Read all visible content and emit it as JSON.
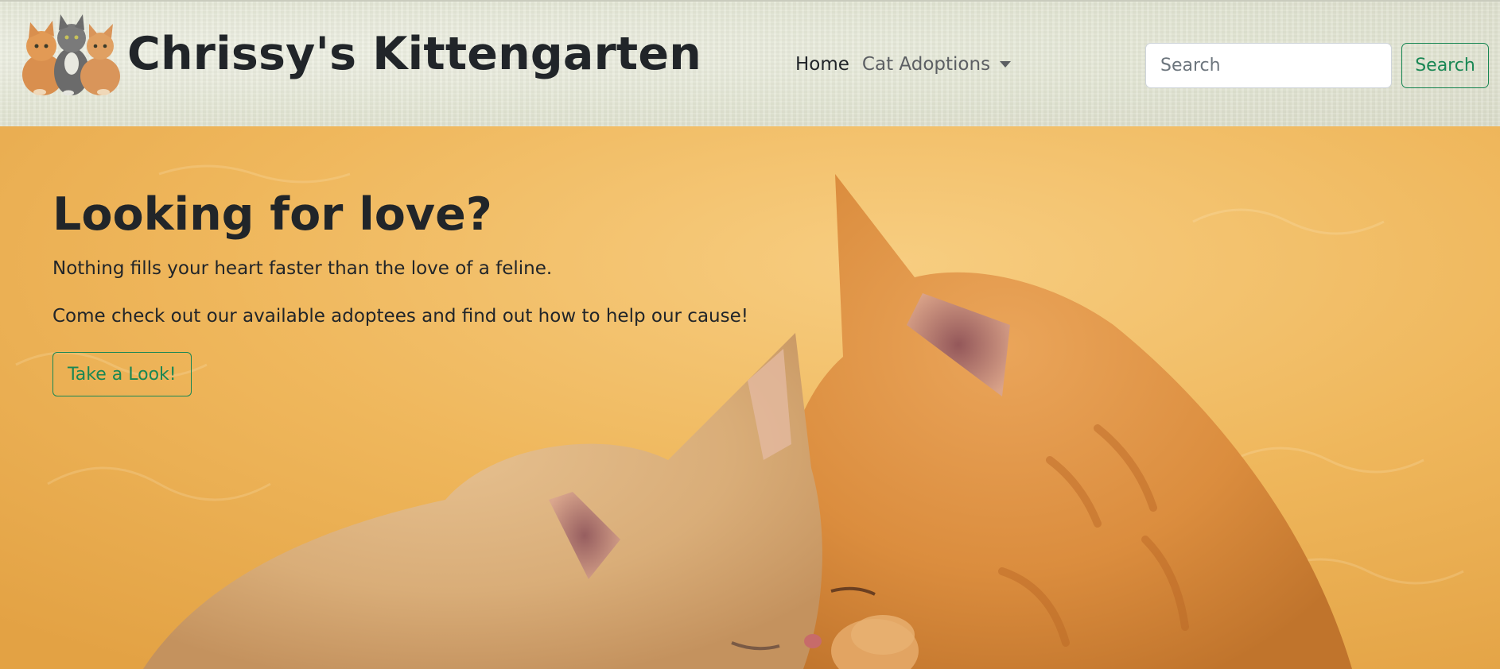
{
  "brand": {
    "name": "Chrissy's Kittengarten",
    "logo_icon": "three-kittens-logo-icon"
  },
  "nav": {
    "items": [
      {
        "label": "Home",
        "active": true
      },
      {
        "label": "Cat Adoptions",
        "dropdown": true
      }
    ],
    "dropdown_icon": "caret-down-icon"
  },
  "search": {
    "placeholder": "Search",
    "value": "",
    "button_label": "Search"
  },
  "hero": {
    "title": "Looking for love?",
    "text_1": "Nothing fills your heart faster than the love of a feline.",
    "text_2": "Come check out our available adoptees and find out how to help our cause!",
    "button_label": "Take a Look!",
    "background_image": "two-orange-kittens-cuddling"
  },
  "colors": {
    "accent_green": "#198754",
    "text_dark": "#212529",
    "nav_bg": "#e2e5d3",
    "hero_orange": "#eeb455"
  }
}
